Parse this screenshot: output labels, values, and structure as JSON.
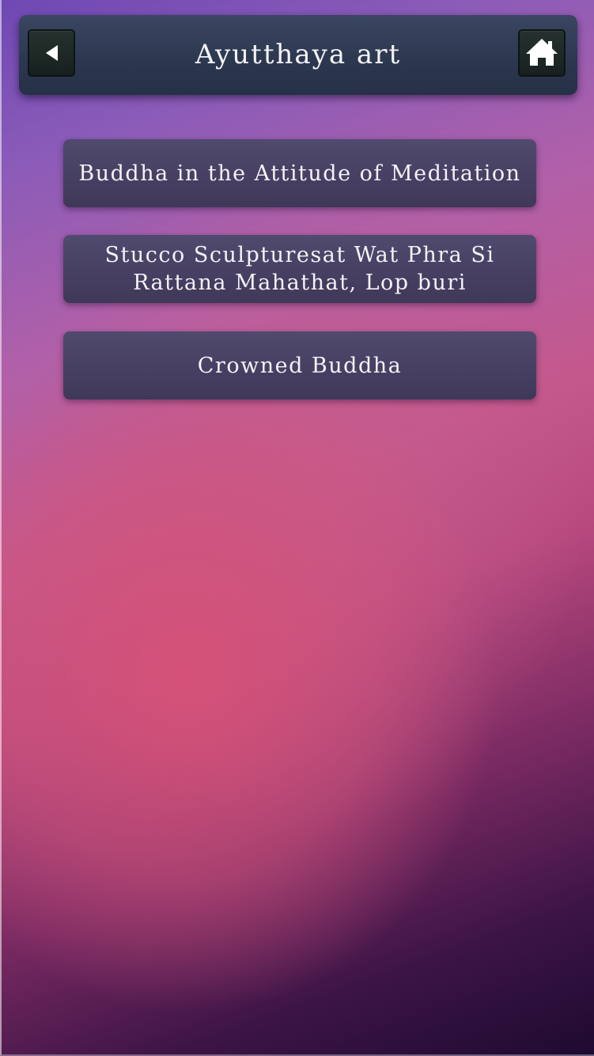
{
  "header": {
    "title": "Ayutthaya art",
    "back_icon": "back-arrow-icon",
    "home_icon": "home-icon"
  },
  "menu": {
    "items": [
      {
        "label": "Buddha in the Attitude of Meditation"
      },
      {
        "label": "Stucco Sculpturesat Wat Phra Si Rattana Mahathat, Lop buri"
      },
      {
        "label": "Crowned Buddha"
      }
    ]
  },
  "colors": {
    "header_bg": "#2d3850",
    "button_bg": "#463f62",
    "text": "#f3f3f6",
    "bg_top": "#7a4cb8",
    "bg_middle": "#c4588c",
    "bg_bottom": "#1e0a30"
  }
}
